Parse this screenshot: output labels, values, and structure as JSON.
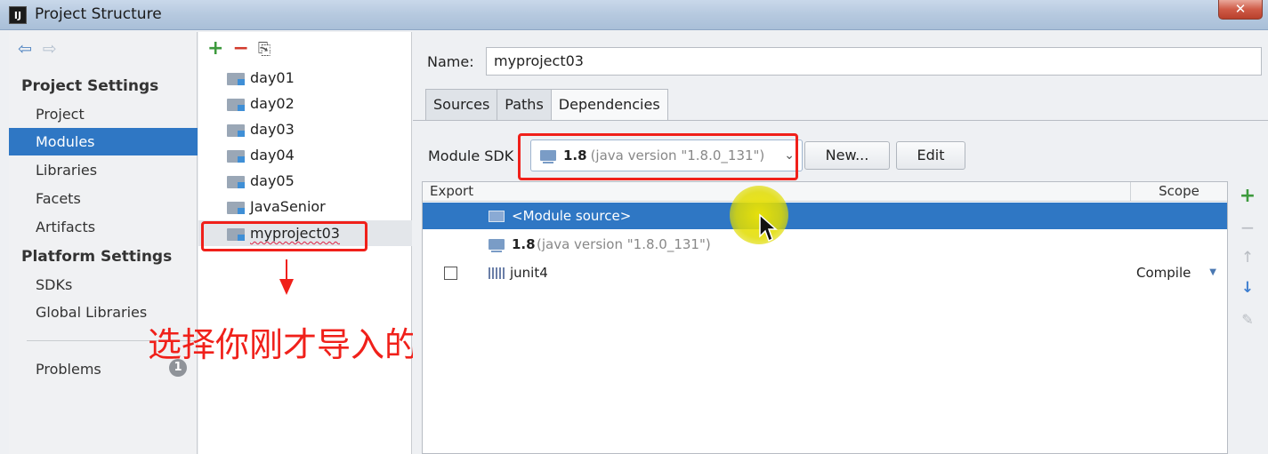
{
  "window": {
    "title": "Project Structure",
    "app_icon": "IJ",
    "close": "✕"
  },
  "nav": {
    "back_icon": "arrow-left-icon",
    "forward_icon": "arrow-right-icon",
    "project_settings_heading": "Project Settings",
    "project_items": [
      "Project",
      "Modules",
      "Libraries",
      "Facets",
      "Artifacts"
    ],
    "selected": "Modules",
    "platform_settings_heading": "Platform Settings",
    "platform_items": [
      "SDKs",
      "Global Libraries"
    ],
    "problems": {
      "label": "Problems",
      "count": "1"
    }
  },
  "modules": {
    "toolbar": {
      "add": "+",
      "remove": "−",
      "copy": "⎘"
    },
    "items": [
      "day01",
      "day02",
      "day03",
      "day04",
      "day05",
      "JavaSenior",
      "myproject03"
    ],
    "selected": "myproject03"
  },
  "annotation": {
    "text": "选择你刚才导入的项目",
    "color": "#f0201a"
  },
  "detail": {
    "name_label": "Name:",
    "name_value": "myproject03",
    "tabs": [
      "Sources",
      "Paths",
      "Dependencies"
    ],
    "active_tab": "Dependencies",
    "sdk_label": "Module SDK",
    "sdk_version": "1.8",
    "sdk_detail": "(java version \"1.8.0_131\")",
    "new_button": "New...",
    "edit_button": "Edit",
    "table": {
      "columns": [
        "Export",
        "Scope"
      ],
      "rows": [
        {
          "name": "<Module source>",
          "detail": "",
          "scope": "",
          "selected": true,
          "checkbox": false
        },
        {
          "name": "1.8",
          "detail": "(java version \"1.8.0_131\")",
          "scope": "",
          "selected": false,
          "checkbox": false
        },
        {
          "name": "junit4",
          "detail": "",
          "scope": "Compile",
          "selected": false,
          "checkbox": true
        }
      ]
    },
    "side_tools": {
      "add": "+",
      "remove": "−",
      "up": "↑",
      "down": "↓",
      "edit": "✎"
    }
  },
  "colors": {
    "selection": "#2f77c4",
    "annotation_red": "#f0201a",
    "cursor_highlight": "#e8e000"
  }
}
